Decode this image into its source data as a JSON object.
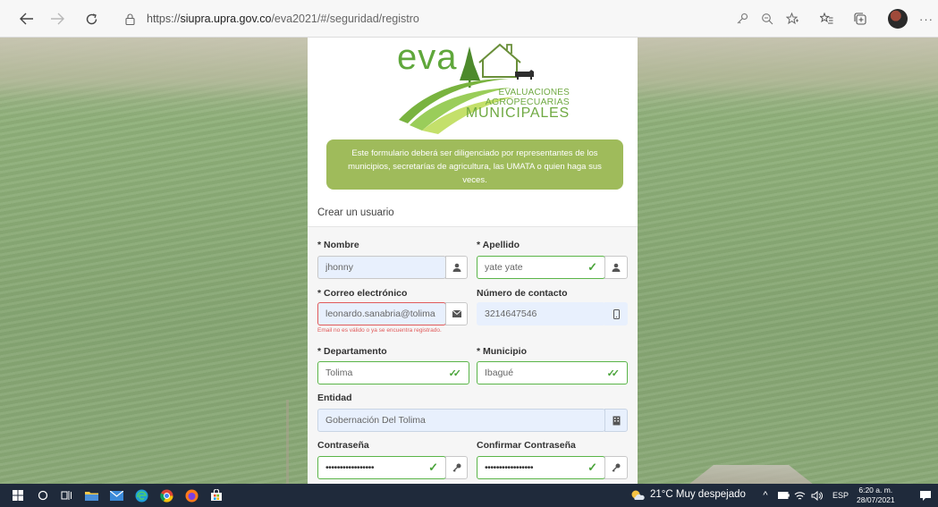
{
  "browser": {
    "url_prefix": "https://",
    "url_host": "siupra.upra.gov.co",
    "url_path": "/eva2021/#/seguridad/registro"
  },
  "logo": {
    "eva_text": "eva",
    "line1": "EVALUACIONES",
    "line2": "AGROPECUARIAS",
    "line3": "MUNICIPALES"
  },
  "notice": "Este formulario deberá ser diligenciado por representantes de los municipios, secretarías de agricultura, las UMATA o quien haga sus veces.",
  "form": {
    "title": "Crear un usuario",
    "nombre_label": "* Nombre",
    "nombre_value": "jhonny",
    "apellido_label": "* Apellido",
    "apellido_value": "yate yate",
    "correo_label": "* Correo electrónico",
    "correo_value": "leonardo.sanabria@tolima",
    "correo_error": "Email no es válido o ya se encuentra registrado.",
    "contacto_label": "Número de contacto",
    "contacto_value": "3214647546",
    "departamento_label": "* Departamento",
    "departamento_value": "Tolima",
    "municipio_label": "* Municipio",
    "municipio_value": "Ibagué",
    "entidad_label": "Entidad",
    "entidad_value": "Gobernación Del Tolima",
    "contrasena_label": "Contraseña",
    "contrasena_value": "•••••••••••••••••",
    "confirmar_label": "Confirmar Contraseña",
    "confirmar_value": "•••••••••••••••••"
  },
  "taskbar": {
    "weather": "21°C  Muy despejado",
    "language": "ESP",
    "time": "6:20 a. m.",
    "date": "28/07/2021",
    "notification_count": "4"
  },
  "colors": {
    "accent_green": "#5fa73b",
    "notice_bg": "#9fbb5b",
    "error_red": "#e05a5a",
    "valid_green": "#5ab548",
    "taskbar_bg": "#1f2a3b"
  }
}
